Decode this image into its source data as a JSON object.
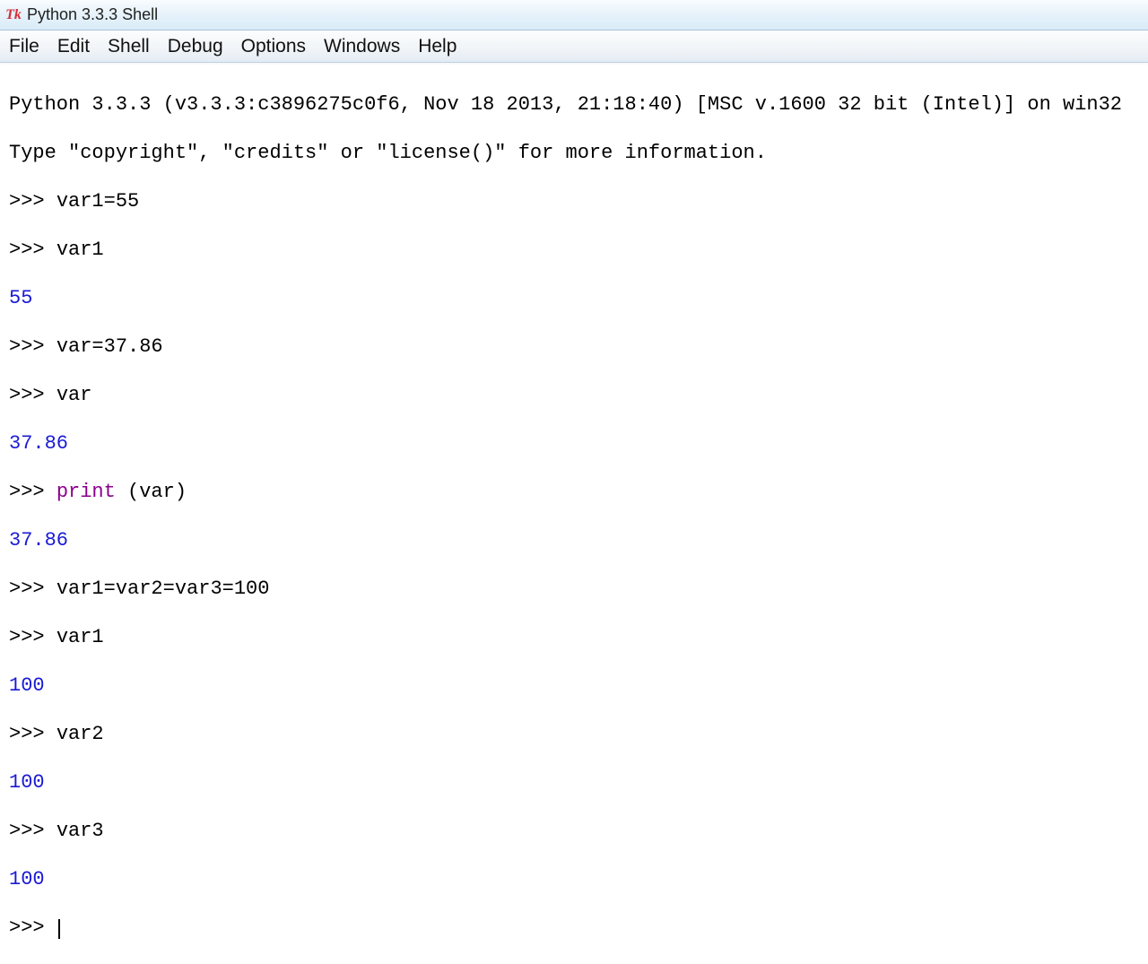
{
  "title_bar": {
    "app_name": "Python 3.3.3 Shell",
    "icon_text": "Tk"
  },
  "menu": {
    "file": "File",
    "edit": "Edit",
    "shell": "Shell",
    "debug": "Debug",
    "options": "Options",
    "windows": "Windows",
    "help": "Help"
  },
  "console": {
    "intro1": "Python 3.3.3 (v3.3.3:c3896275c0f6, Nov 18 2013, 21:18:40) [MSC v.1600 32 bit (Intel)] on win32",
    "intro2": "Type \"copyright\", \"credits\" or \"license()\" for more information.",
    "prompt": ">>> ",
    "lines": {
      "l1": "var1=55",
      "l2": "var1",
      "out1": "55",
      "l3": "var=37.86",
      "l4": "var",
      "out2": "37.86",
      "l5_print": "print",
      "l5_rest": " (var)",
      "out3": "37.86",
      "l6": "var1=var2=var3=100",
      "l7": "var1",
      "out4": "100",
      "l8": "var2",
      "out5": "100",
      "l9": "var3",
      "out6": "100"
    }
  }
}
